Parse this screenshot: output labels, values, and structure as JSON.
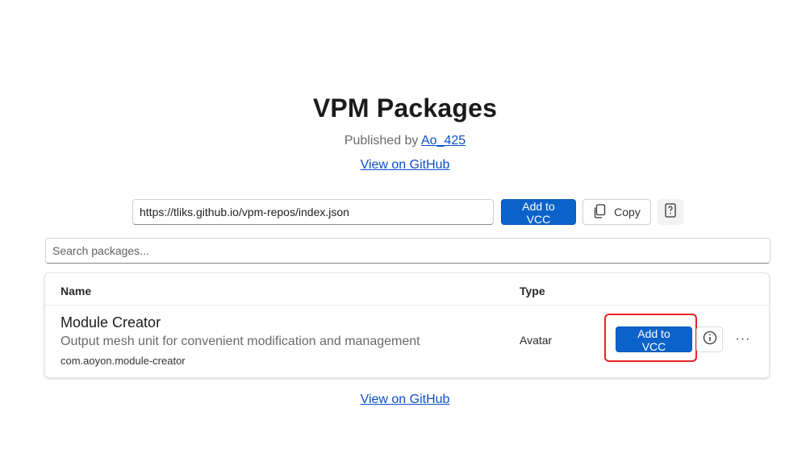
{
  "header": {
    "title": "VPM Packages",
    "published_by_prefix": "Published by ",
    "publisher_name": "Ao_425",
    "github_link": "View on GitHub"
  },
  "repo_bar": {
    "url_value": "https://tliks.github.io/vpm-repos/index.json",
    "add_label": "Add to VCC",
    "copy_label": "Copy"
  },
  "search": {
    "placeholder": "Search packages..."
  },
  "table": {
    "columns": [
      "Name",
      "Type"
    ],
    "rows": [
      {
        "display_name": "Module Creator",
        "description": "Output mesh unit for convenient modification and management",
        "package_id": "com.aoyon.module-creator",
        "type": "Avatar",
        "add_label": "Add to VCC",
        "more_glyph": "···"
      }
    ]
  },
  "footer": {
    "github_link": "View on GitHub"
  },
  "colors": {
    "primary": "#0b63c9",
    "link": "#0b4fc8",
    "highlight": "#e52323"
  },
  "icons": [
    "copy-icon",
    "help-icon",
    "info-icon",
    "more-icon"
  ]
}
